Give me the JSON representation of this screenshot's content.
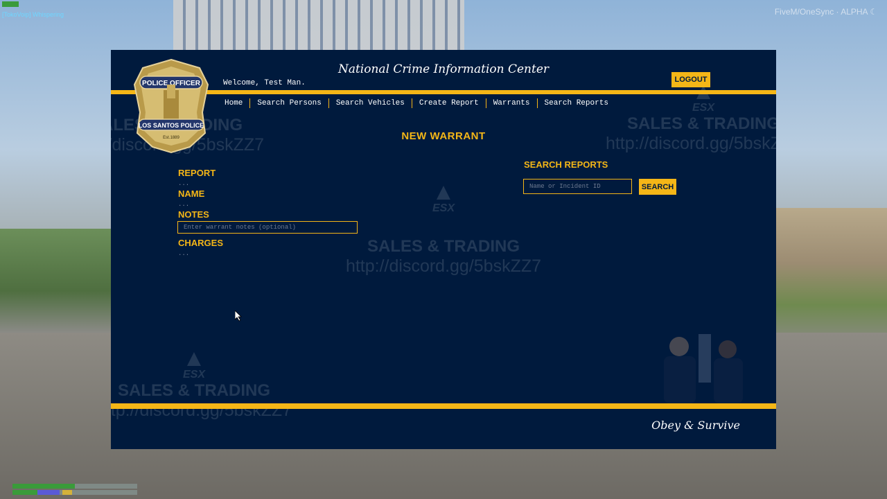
{
  "hud": {
    "voice_status": "[TokoVoip] Whispering",
    "server_tag": "FiveM/OneSync · ALPHA"
  },
  "mdt": {
    "title": "National Crime Information Center",
    "welcome": "Welcome, Test Man.",
    "logout_label": "LOGOUT",
    "nav": [
      "Home",
      "Search Persons",
      "Search Vehicles",
      "Create Report",
      "Warrants",
      "Search Reports"
    ],
    "badge": {
      "top_text": "POLICE OFFICER",
      "bottom_text": "LOS SANTOS POLICE",
      "est": "Est.1889"
    },
    "page_heading": "NEW WARRANT",
    "form": {
      "report_label": "REPORT",
      "report_value": "...",
      "name_label": "NAME",
      "name_value": "...",
      "notes_label": "NOTES",
      "notes_placeholder": "Enter warrant notes (optional)",
      "charges_label": "CHARGES",
      "charges_value": "..."
    },
    "search": {
      "heading": "SEARCH REPORTS",
      "placeholder": "Name or Incident ID",
      "button_label": "SEARCH"
    },
    "motto": "Obey & Survive"
  },
  "watermark": {
    "sales": "SALES & TRADING",
    "url": "http://discord.gg/5bskZZ7",
    "esx": "ESX"
  },
  "colors": {
    "panel_bg": "#001a3d",
    "accent": "#f5b617",
    "text": "#ffffff"
  }
}
